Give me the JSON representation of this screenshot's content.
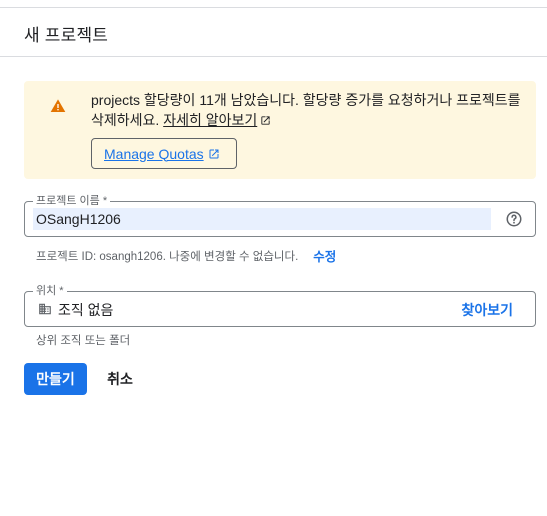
{
  "page": {
    "title": "새 프로젝트"
  },
  "warning": {
    "icon": "warning-icon",
    "text_prefix": "projects 할당량이 11개 남았습니다. 할당량 증가를 요청하거나 프로젝트를 삭제하세요. ",
    "learn_more_label": "자세히 알아보기",
    "manage_quotas_label": "Manage Quotas",
    "background_color": "#fef7e0",
    "icon_color": "#e37400"
  },
  "project_name": {
    "label": "프로젝트 이름 *",
    "value": "OSangH1206",
    "help_icon": "help-icon"
  },
  "project_id": {
    "text": "프로젝트 ID: osangh1206. 나중에 변경할 수 없습니다.",
    "edit_label": "수정"
  },
  "location": {
    "label": "위치 *",
    "value": "조직 없음",
    "icon": "building-icon",
    "browse_label": "찾아보기",
    "hint": "상위 조직 또는 폴더"
  },
  "actions": {
    "create_label": "만들기",
    "cancel_label": "취소"
  },
  "colors": {
    "accent": "#1a73e8"
  }
}
